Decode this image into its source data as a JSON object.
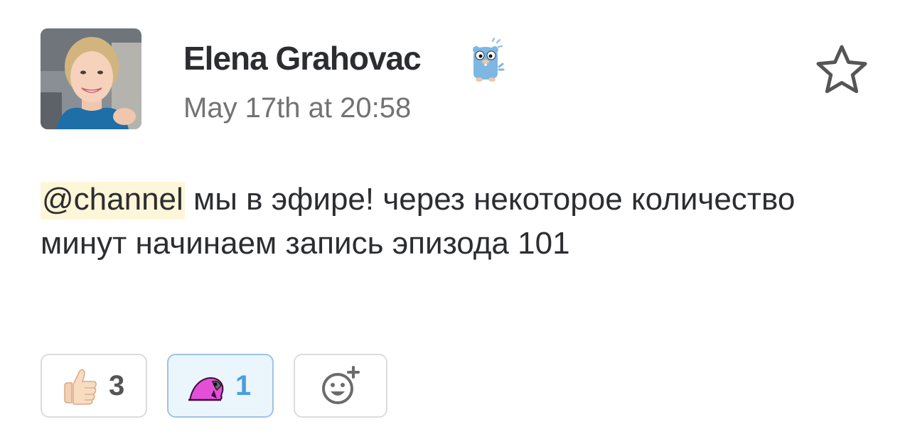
{
  "message": {
    "author": "Elena Grahovac",
    "timestamp": "May 17th at 20:58",
    "mention": "@channel",
    "text": " мы в эфире! через некоторое количество минут начинаем запись эпизода 101",
    "star_icon": "star-outline-icon",
    "status_icon": "gopher-icon"
  },
  "reactions": [
    {
      "emoji": "thumbs-up-icon",
      "count": "3"
    },
    {
      "emoji": "parrot-icon",
      "count": "1",
      "active": true
    },
    {
      "emoji": "add-reaction-icon"
    }
  ],
  "colors": {
    "mention_bg": "#fdf6d8",
    "active_reaction_border": "#9dc4e6",
    "active_reaction_bg": "#eaf5fc",
    "active_count": "#4a9fdd"
  }
}
